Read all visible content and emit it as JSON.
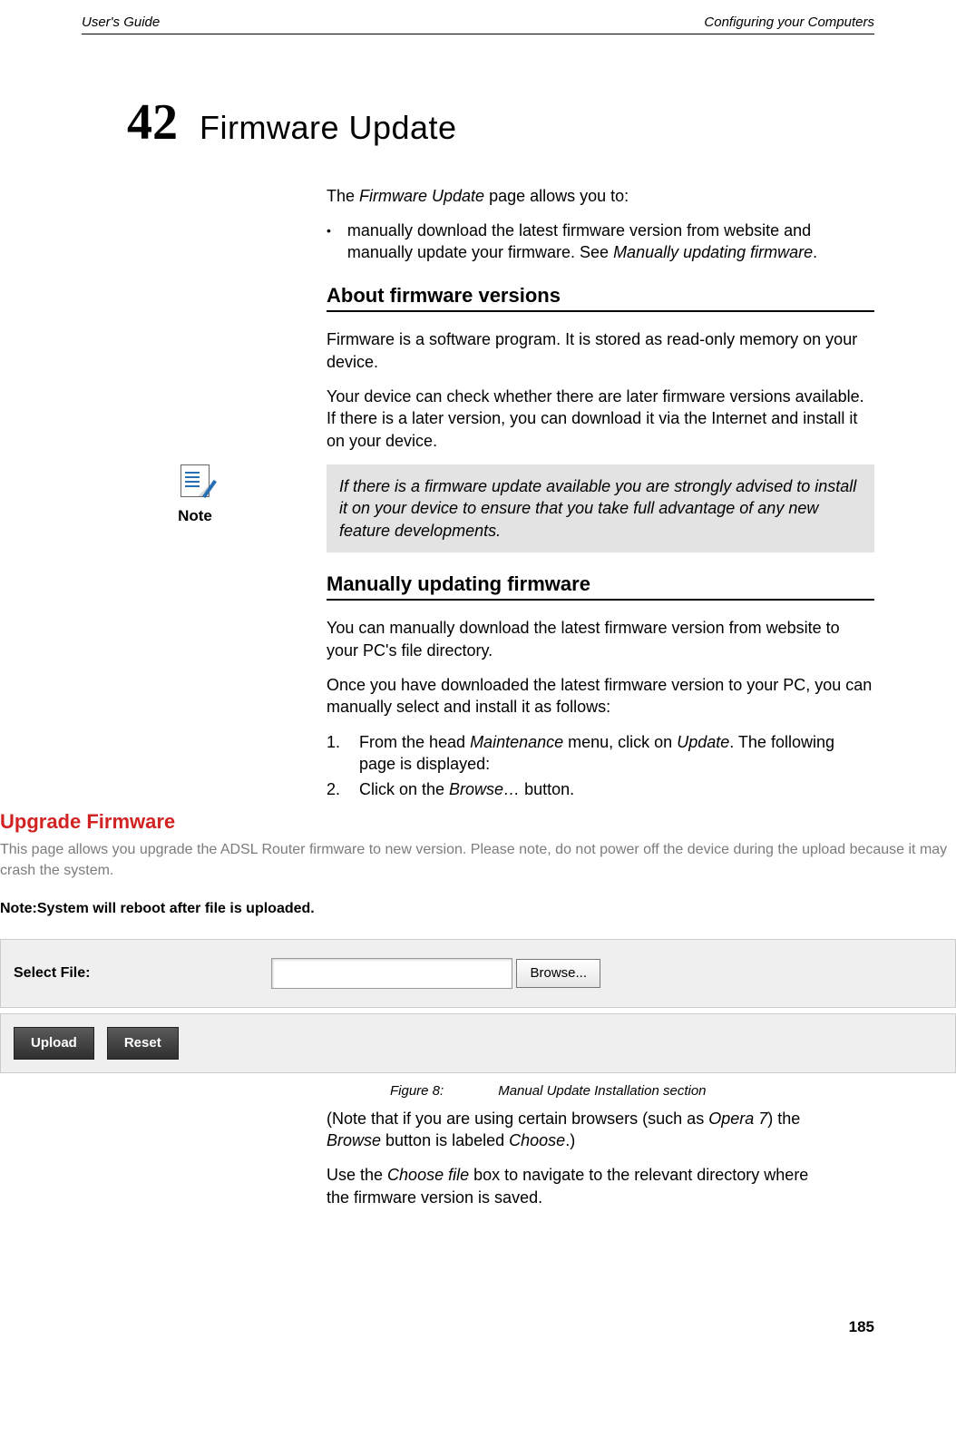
{
  "header": {
    "left": "User's Guide",
    "right": "Configuring your Computers"
  },
  "chapter": {
    "number": "42",
    "title": "Firmware Update"
  },
  "intro": {
    "lead_before_em": "The ",
    "lead_em": "Firmware Update",
    "lead_after_em": " page allows you to:",
    "bullet_text_seg1": "manually download the latest firmware version from website and manually update your firmware. See ",
    "bullet_em": "Manually updating firmware",
    "bullet_text_seg2": "."
  },
  "sec1": {
    "heading": "About firmware versions",
    "p1": "Firmware is a software program. It is stored as read-only memory on your device.",
    "p2": "Your device can check whether there are later firmware versions available. If there is a later version, you can download it via the Internet and install it on your device."
  },
  "note": {
    "label": "Note",
    "text": "If there is a firmware update available you are strongly advised to install it on your device to ensure that you take full advantage of any new feature developments."
  },
  "sec2": {
    "heading": "Manually updating firmware",
    "p1": "You can manually download the latest firmware version from website to your PC's file directory.",
    "p2": "Once you have downloaded the latest firmware version to your PC, you can manually select and install it as follows:",
    "step1_num": "1.",
    "step1_seg1": "From the head ",
    "step1_em1": "Maintenance",
    "step1_seg2": " menu, click on ",
    "step1_em2": "Update",
    "step1_seg3": ". The following page is displayed:",
    "step2_num": "2.",
    "step2_seg1": "Click on the ",
    "step2_em1": "Browse…",
    "step2_seg2": " button."
  },
  "screenshot": {
    "title": "Upgrade Firmware",
    "desc": "This page allows you upgrade the ADSL Router firmware to new version. Please note, do not power off the device during the upload because it may crash the system.",
    "note_line": "Note:System will reboot after file is uploaded.",
    "file_label": "Select File:",
    "file_value": "",
    "browse_btn": "Browse...",
    "upload_btn": "Upload",
    "reset_btn": "Reset"
  },
  "figure": {
    "label": "Figure 8:",
    "caption": "Manual Update Installation section"
  },
  "after": {
    "p1_seg1": "(Note that if you are using certain browsers (such as ",
    "p1_em1": "Opera 7",
    "p1_seg2": ") the ",
    "p1_em2": "Browse",
    "p1_seg3": " button is labeled ",
    "p1_em3": "Choose",
    "p1_seg4": ".)",
    "p2_seg1": "Use the ",
    "p2_em1": "Choose file",
    "p2_seg2": " box to navigate to the relevant directory where the firmware version is saved."
  },
  "page_number": "185"
}
